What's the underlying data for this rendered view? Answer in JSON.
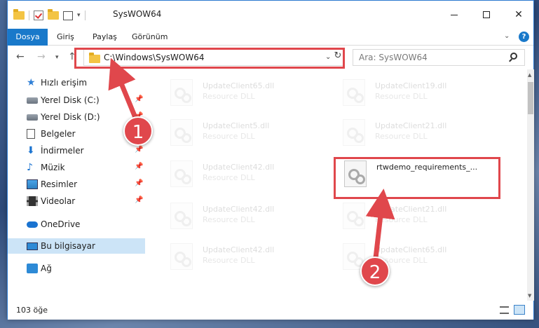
{
  "window": {
    "title": "SysWOW64"
  },
  "ribbon": {
    "tabs": [
      "Dosya",
      "Giriş",
      "Paylaş",
      "Görünüm"
    ]
  },
  "navigation": {
    "address": "C:\\Windows\\SysWOW64",
    "search_placeholder": "Ara: SysWOW64"
  },
  "sidebar": {
    "items": [
      {
        "label": "Hızlı erişim",
        "icon": "star-icon"
      },
      {
        "label": "Yerel Disk (C:)",
        "icon": "disk-icon",
        "pinned": true
      },
      {
        "label": "Yerel Disk (D:)",
        "icon": "disk-icon",
        "pinned": true
      },
      {
        "label": "Belgeler",
        "icon": "document-icon",
        "pinned": true
      },
      {
        "label": "İndirmeler",
        "icon": "download-icon",
        "pinned": true
      },
      {
        "label": "Müzik",
        "icon": "music-icon",
        "pinned": true
      },
      {
        "label": "Resimler",
        "icon": "pictures-icon",
        "pinned": true
      },
      {
        "label": "Videolar",
        "icon": "video-icon",
        "pinned": true
      },
      {
        "label": "OneDrive",
        "icon": "cloud-icon"
      },
      {
        "label": "Bu bilgisayar",
        "icon": "computer-icon",
        "selected": true
      },
      {
        "label": "Ağ",
        "icon": "network-icon"
      }
    ]
  },
  "files": [
    {
      "name": "UpdateClient65.dll",
      "type": "Resource DLL",
      "faded": true
    },
    {
      "name": "UpdateClient19.dll",
      "type": "Resource DLL",
      "faded": true
    },
    {
      "name": "UpdateClient5.dll",
      "type": "Resource DLL",
      "faded": true
    },
    {
      "name": "UpdateClient21.dll",
      "type": "Resource DLL",
      "faded": true
    },
    {
      "name": "UpdateClient42.dll",
      "type": "Resource DLL",
      "faded": true
    },
    {
      "name": "rtwdemo_requirements_...",
      "type": "",
      "faded": false
    },
    {
      "name": "UpdateClient42.dll",
      "type": "Resource DLL",
      "faded": true
    },
    {
      "name": "UpdateClient21.dll",
      "type": "Resource DLL",
      "faded": true
    },
    {
      "name": "UpdateClient42.dll",
      "type": "Resource DLL",
      "faded": true
    },
    {
      "name": "UpdateClient65.dll",
      "type": "Resource DLL",
      "faded": true
    }
  ],
  "status": {
    "item_count": "103 öğe"
  },
  "annotations": {
    "step1": "1",
    "step2": "2",
    "color": "#e0474c"
  }
}
